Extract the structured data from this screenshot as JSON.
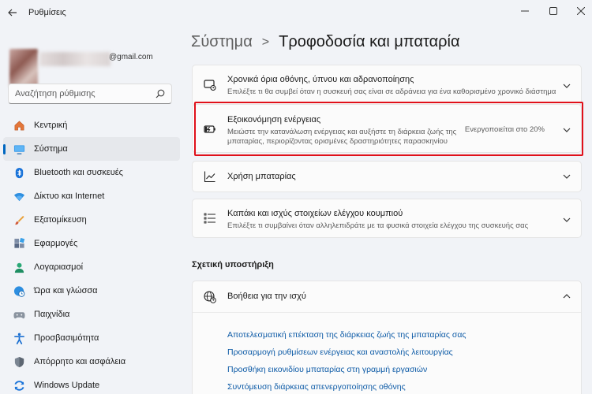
{
  "window": {
    "title": "Ρυθμίσεις",
    "back_icon": "arrow-left-icon",
    "minimize_icon": "minimize-icon",
    "maximize_icon": "maximize-icon",
    "close_icon": "close-icon"
  },
  "account": {
    "email": "@gmail.com"
  },
  "search": {
    "placeholder": "Αναζήτηση ρύθμισης",
    "value": ""
  },
  "sidebar": {
    "active_index": 1,
    "items": [
      {
        "label": "Κεντρική",
        "icon": "home-icon"
      },
      {
        "label": "Σύστημα",
        "icon": "monitor-icon"
      },
      {
        "label": "Bluetooth και συσκευές",
        "icon": "bluetooth-icon"
      },
      {
        "label": "Δίκτυο και Internet",
        "icon": "wifi-icon"
      },
      {
        "label": "Εξατομίκευση",
        "icon": "brush-icon"
      },
      {
        "label": "Εφαρμογές",
        "icon": "apps-icon"
      },
      {
        "label": "Λογαριασμοί",
        "icon": "person-icon"
      },
      {
        "label": "Ώρα και γλώσσα",
        "icon": "globe-clock-icon"
      },
      {
        "label": "Παιχνίδια",
        "icon": "gamepad-icon"
      },
      {
        "label": "Προσβασιμότητα",
        "icon": "accessibility-icon"
      },
      {
        "label": "Απόρρητο και ασφάλεια",
        "icon": "shield-icon"
      },
      {
        "label": "Windows Update",
        "icon": "windows-update-icon"
      }
    ]
  },
  "breadcrumb": {
    "parent": "Σύστημα",
    "separator": ">",
    "current": "Τροφοδοσία και μπαταρία"
  },
  "cards": [
    {
      "title": "Χρονικά όρια οθόνης, ύπνου και αδρανοποίησης",
      "description": "Επιλέξτε τι θα συμβεί όταν η συσκευή σας είναι σε αδράνεια για ένα καθορισμένο χρονικό διάστημα",
      "icon": "screen-sleep-icon"
    },
    {
      "title": "Εξοικονόμηση ενέργειας",
      "description_line1": "Μειώστε την κατανάλωση ενέργειας και αυξήστε τη διάρκεια ζωής της",
      "description_line2": "μπαταρίας, περιορίζοντας ορισμένες δραστηριότητες παρασκηνίου",
      "status": "Ενεργοποιείται στο 20%",
      "icon": "energy-saver-icon"
    },
    {
      "title": "Χρήση μπαταρίας",
      "icon": "chart-line-icon"
    },
    {
      "title": "Καπάκι και ισχύς στοιχείων ελέγχου κουμπιού",
      "description": "Επιλέξτε τι συμβαίνει όταν αλληλεπιδράτε με τα φυσικά στοιχεία ελέγχου της συσκευής σας",
      "icon": "list-settings-icon"
    }
  ],
  "related_support": {
    "section_title": "Σχετική υποστήριξη",
    "card_title": "Βοήθεια για την ισχύ",
    "icon": "globe-help-icon",
    "links": [
      "Αποτελεσματική επέκταση της διάρκειας ζωής της μπαταρίας σας",
      "Προσαρμογή ρυθμίσεων ενέργειας και αναστολής λειτουργίας",
      "Προσθήκη εικονιδίου μπαταρίας στη γραμμή εργασιών",
      "Συντόμευση διάρκειας απενεργοποίησης οθόνης"
    ]
  },
  "colors": {
    "accent": "#0067c0",
    "highlight_border": "#e0101a",
    "link": "#0c5aa6"
  }
}
